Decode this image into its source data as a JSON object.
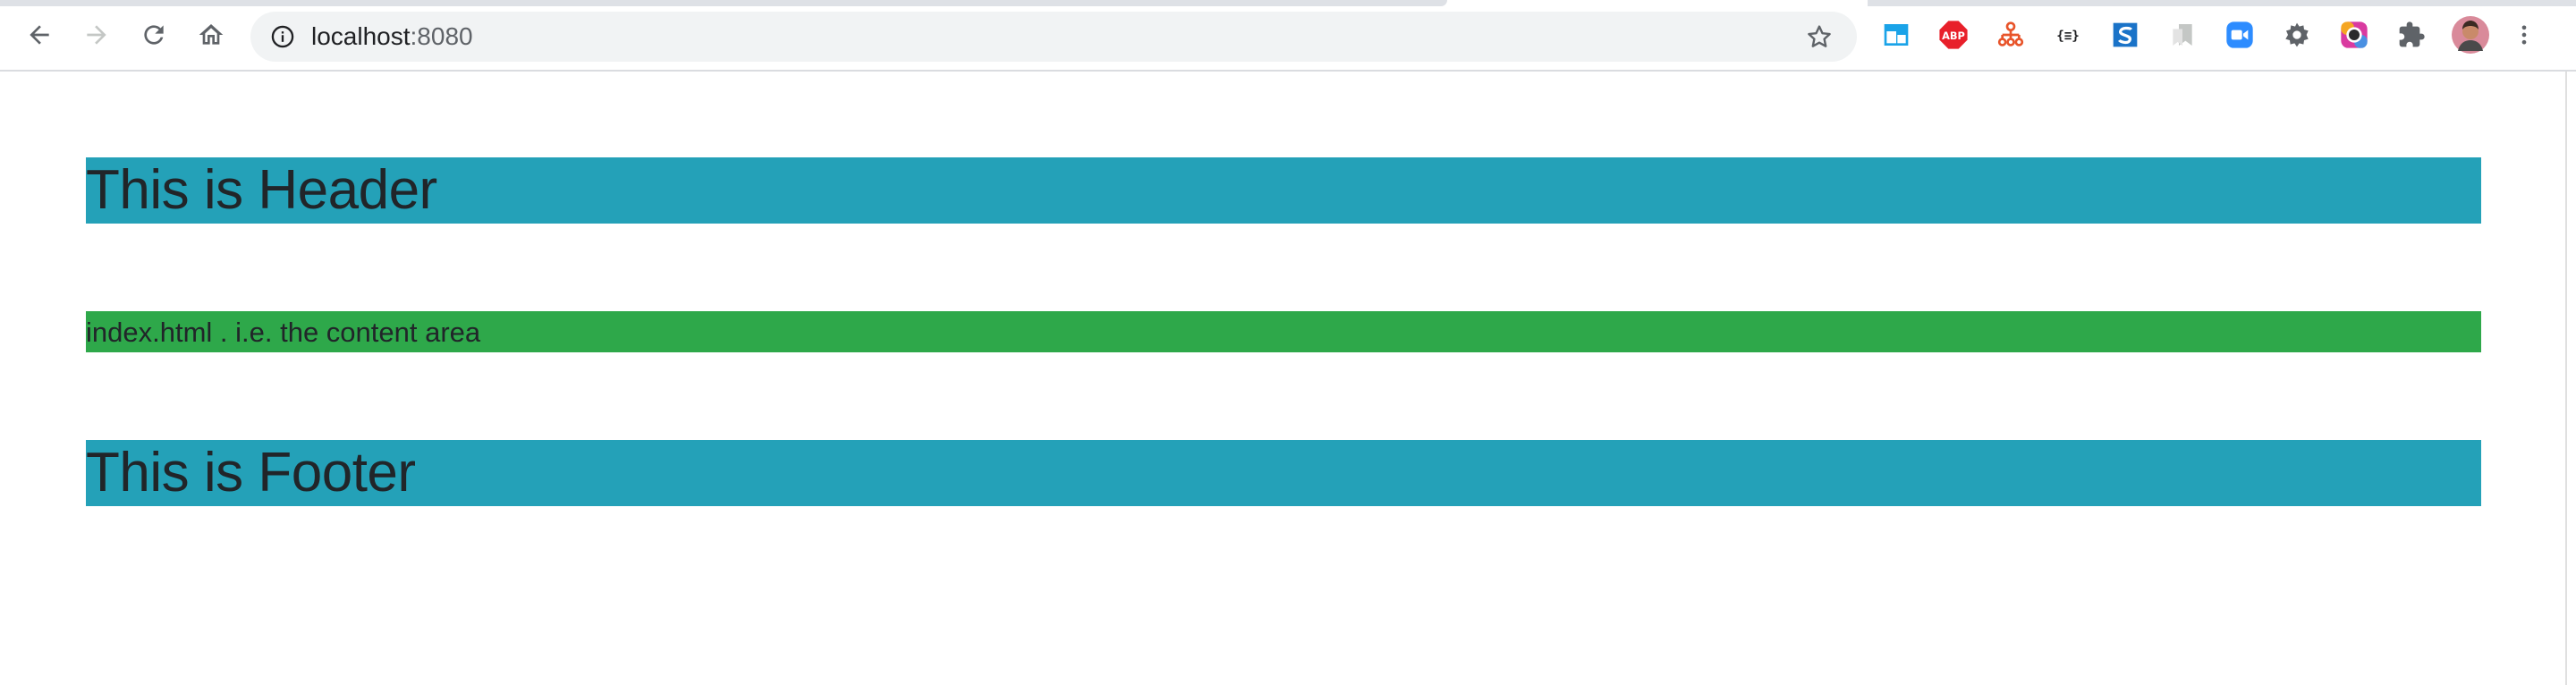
{
  "browser": {
    "url_host": "localhost",
    "url_port": ":8080",
    "colors": {
      "toolbar": "#ffffff",
      "omnibox": "#f1f3f4",
      "icon": "#5f6368",
      "icon_disabled": "#c4c7c5"
    },
    "nav_icons": [
      "back-icon",
      "forward-icon",
      "reload-icon",
      "home-icon"
    ],
    "extensions": [
      {
        "name": "tab-manager-extension-icon",
        "color": "#1aa3e8"
      },
      {
        "name": "adblock-plus-extension-icon",
        "label": "ABP",
        "color": "#e8202a"
      },
      {
        "name": "sitemap-extension-icon",
        "color": "#e8542a"
      },
      {
        "name": "json-formatter-extension-icon",
        "label": "{≡}",
        "color": "#202124"
      },
      {
        "name": "stylish-extension-icon",
        "color": "#1a73c8"
      },
      {
        "name": "bookmark-extension-icon",
        "color": "#c4c7c5"
      },
      {
        "name": "zoom-extension-icon",
        "color": "#2d8cff"
      },
      {
        "name": "settings-gear-extension-icon",
        "color": "#5f6368"
      },
      {
        "name": "color-picker-extension-icon",
        "color": "#d93aa0"
      },
      {
        "name": "extensions-puzzle-icon",
        "color": "#5f6368"
      }
    ]
  },
  "page": {
    "header_title": "This is Header",
    "content_text": "index.html . i.e. the content area",
    "footer_title": "This is Footer",
    "colors": {
      "header": "#24a1b8",
      "content": "#2ea84a",
      "footer": "#24a1b8",
      "text": "#212529"
    }
  }
}
